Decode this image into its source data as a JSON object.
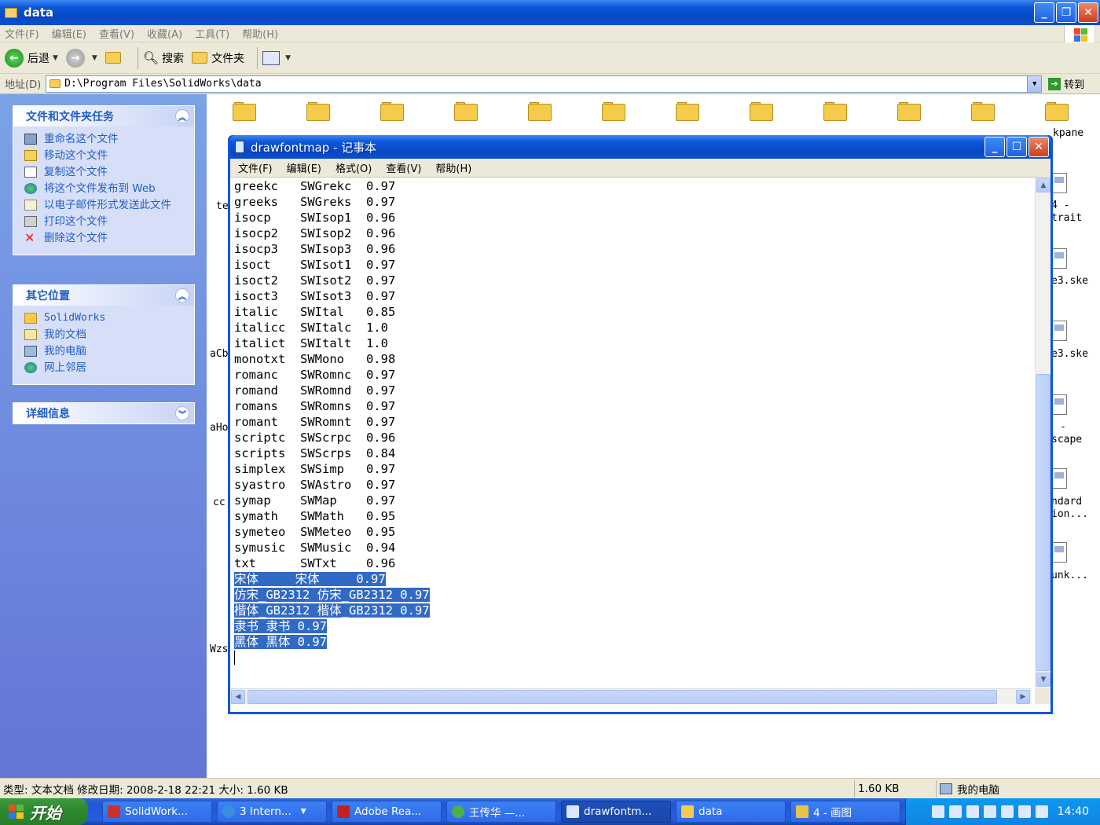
{
  "explorer": {
    "title": "data",
    "menu": [
      "文件(F)",
      "编辑(E)",
      "查看(V)",
      "收藏(A)",
      "工具(T)",
      "帮助(H)"
    ],
    "toolbar": {
      "back": "后退",
      "search": "搜索",
      "folders": "文件夹"
    },
    "address": {
      "label": "地址(D)",
      "path": "D:\\Program Files\\SolidWorks\\data",
      "go": "转到"
    }
  },
  "taskpane": {
    "file_tasks": {
      "title": "文件和文件夹任务",
      "items": [
        "重命名这个文件",
        "移动这个文件",
        "复制这个文件",
        "将这个文件发布到 Web",
        "以电子邮件形式发送此文件",
        "打印这个文件",
        "删除这个文件"
      ]
    },
    "other_places": {
      "title": "其它位置",
      "items": [
        "SolidWorks",
        "我的文档",
        "我的电脑",
        "网上邻居"
      ]
    },
    "details": {
      "title": "详细信息"
    }
  },
  "background_peek": {
    "right": [
      "kpane",
      "4 -",
      "trait",
      "e3.ske",
      "e3.ske",
      "-",
      "scape",
      "ndard",
      "ion...",
      "unk..."
    ],
    "left": [
      "te",
      "aCb",
      "aHo",
      "cc",
      "Wzs"
    ]
  },
  "notepad": {
    "title": "drawfontmap - 记事本",
    "menu": [
      "文件(F)",
      "编辑(E)",
      "格式(O)",
      "查看(V)",
      "帮助(H)"
    ],
    "lines": [
      "greekc   SWGrekc  0.97",
      "greeks   SWGreks  0.97",
      "isocp    SWIsop1  0.96",
      "isocp2   SWIsop2  0.96",
      "isocp3   SWIsop3  0.96",
      "isoct    SWIsot1  0.97",
      "isoct2   SWIsot2  0.97",
      "isoct3   SWIsot3  0.97",
      "italic   SWItal   0.85",
      "italicc  SWItalc  1.0",
      "italict  SWItalt  1.0",
      "monotxt  SWMono   0.98",
      "romanc   SWRomnc  0.97",
      "romand   SWRomnd  0.97",
      "romans   SWRomns  0.97",
      "romant   SWRomnt  0.97",
      "scriptc  SWScrpc  0.96",
      "scripts  SWScrps  0.84",
      "simplex  SWSimp   0.97",
      "syastro  SWAstro  0.97",
      "symap    SWMap    0.97",
      "symath   SWMath   0.95",
      "symeteo  SWMeteo  0.95",
      "symusic  SWMusic  0.94",
      "txt      SWTxt    0.96"
    ],
    "selected_lines": [
      "宋体     宋体     0.97",
      "仿宋_GB2312 仿宋_GB2312 0.97",
      "楷体_GB2312 楷体_GB2312 0.97",
      "隶书 隶书 0.97",
      "黑体 黑体 0.97"
    ]
  },
  "statusbar": {
    "info": "类型: 文本文档 修改日期: 2008-2-18 22:21 大小: 1.60 KB",
    "size": "1.60 KB",
    "location": "我的电脑"
  },
  "taskbar": {
    "start": "开始",
    "buttons": [
      "SolidWork...",
      "3 Intern...",
      "Adobe Rea...",
      "王传华 —...",
      "drawfontm...",
      "data",
      "4 - 画图"
    ],
    "clock": "14:40"
  }
}
